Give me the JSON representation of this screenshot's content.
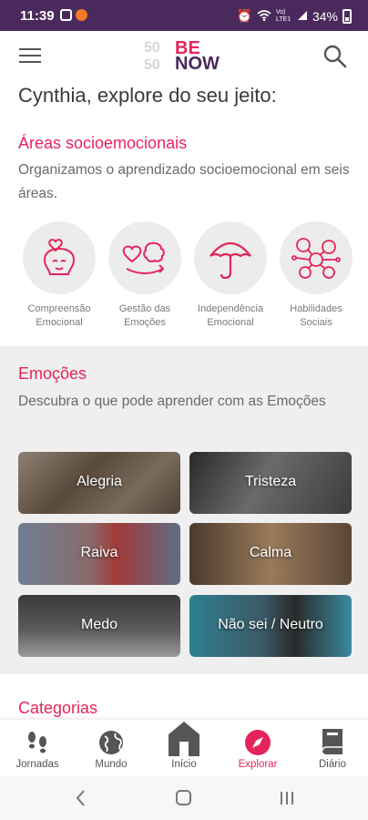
{
  "status_bar": {
    "time": "11:39",
    "network": "Vo) LTE1",
    "battery": "34%"
  },
  "header": {
    "logo_number_top": "50",
    "logo_number_bottom": "50",
    "logo_be": "BE",
    "logo_now": "NOW"
  },
  "greeting": "Cynthia, explore do seu jeito:",
  "areas_section": {
    "title": "Áreas socioemocionais",
    "description": "Organizamos o aprendizado socioemocional em seis áreas.",
    "items": [
      {
        "label": "Compreensão Emocional",
        "icon": "head-heart-icon"
      },
      {
        "label": "Gestão das Emoções",
        "icon": "heart-brain-icon"
      },
      {
        "label": "Independência Emocional",
        "icon": "umbrella-icon"
      },
      {
        "label": "Habilidades Sociais",
        "icon": "network-people-icon"
      }
    ]
  },
  "emotions_section": {
    "title": "Emoções",
    "description": "Descubra o que pode aprender com as Emoções",
    "cards": [
      {
        "label": "Alegria"
      },
      {
        "label": "Tristeza"
      },
      {
        "label": "Raiva"
      },
      {
        "label": "Calma"
      },
      {
        "label": "Medo"
      },
      {
        "label": "Não sei / Neutro"
      }
    ]
  },
  "categories_title": "Categorias",
  "bottom_nav": [
    {
      "label": "Jornadas",
      "icon": "footprints-icon"
    },
    {
      "label": "Mundo",
      "icon": "globe-icon"
    },
    {
      "label": "Início",
      "icon": "home-icon"
    },
    {
      "label": "Explorar",
      "icon": "compass-icon",
      "active": true
    },
    {
      "label": "Diário",
      "icon": "book-icon"
    }
  ],
  "colors": {
    "accent": "#e5245b",
    "brand_dark": "#4a2a5c",
    "status_bar": "#4a2a5c"
  }
}
